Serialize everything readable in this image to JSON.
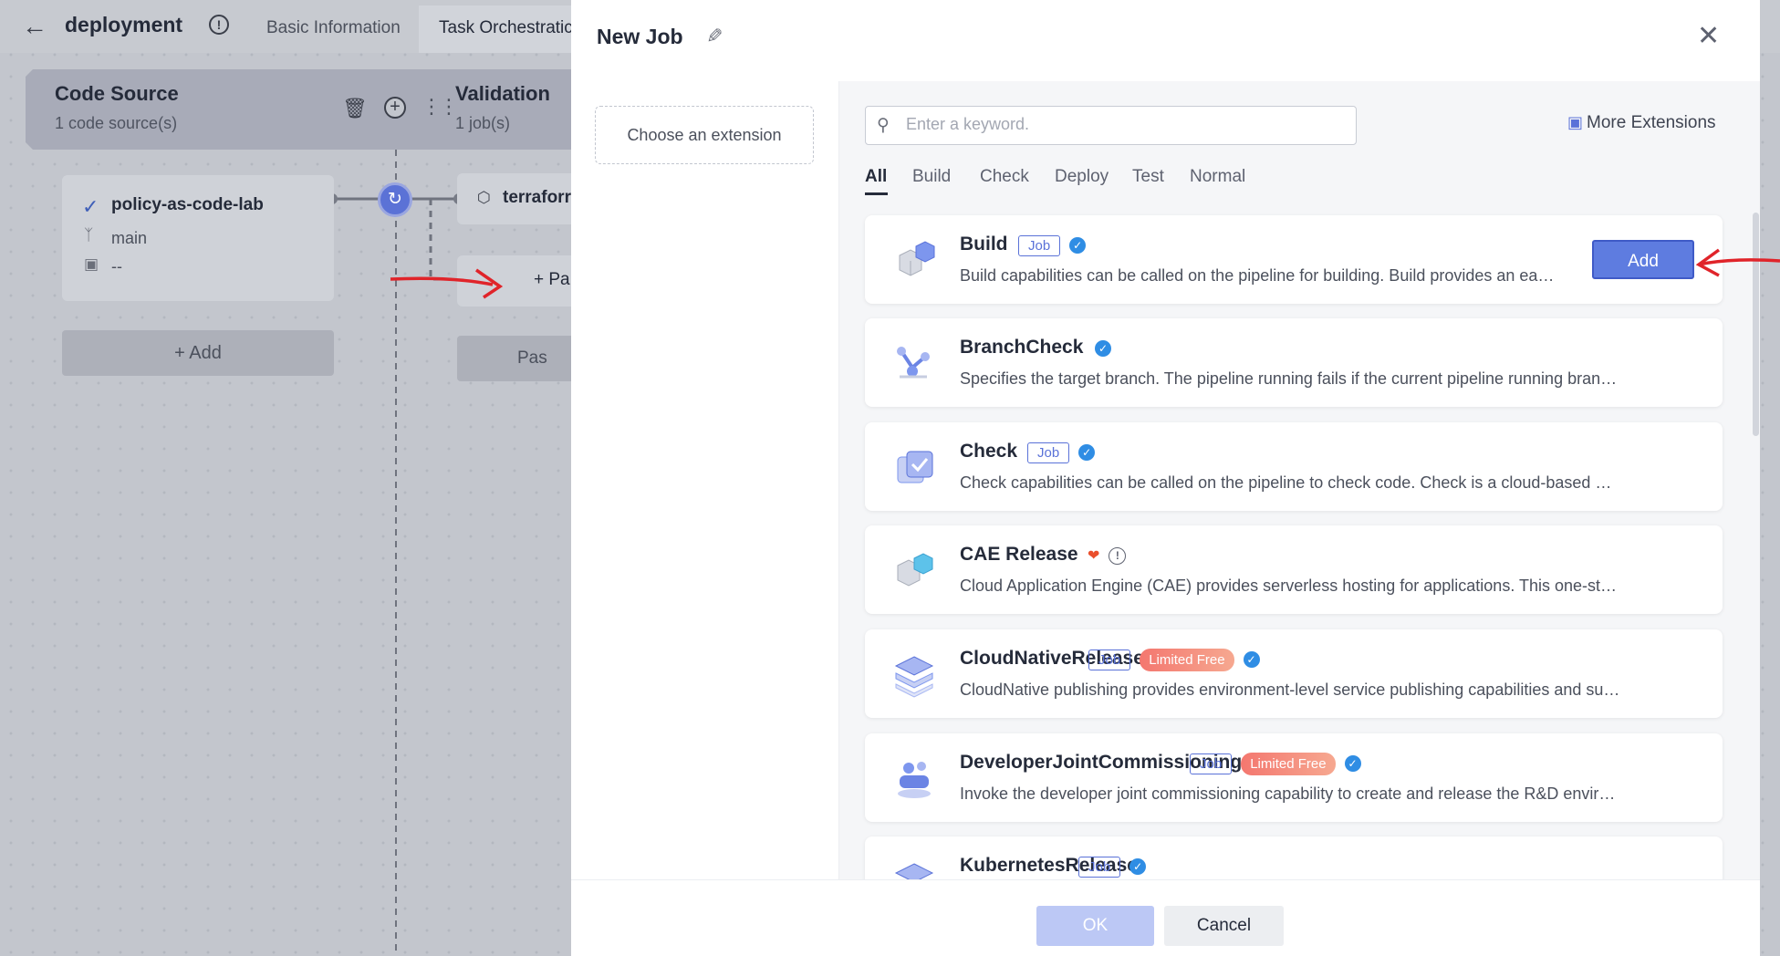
{
  "header": {
    "back_icon": "back-arrow-icon",
    "pipeline_title": "deployment",
    "tabs": [
      "Basic Information",
      "Task Orchestratic"
    ]
  },
  "pipeline": {
    "stages": [
      {
        "title": "Code Source",
        "sub": "1 code source(s)"
      },
      {
        "title": "Validation",
        "sub": "1 job(s)"
      }
    ],
    "repo": {
      "name": "policy-as-code-lab",
      "branch": "main",
      "extra": "--"
    },
    "add_label": "+ Add",
    "job_name": "terraforr",
    "parallel_label": "+ Pa",
    "pass_label": "Pas"
  },
  "drawer": {
    "title": "New Job",
    "choose_extension": "Choose an extension",
    "search_placeholder": "Enter a keyword.",
    "more_extensions": "More Extensions",
    "tabs": [
      "All",
      "Build",
      "Check",
      "Deploy",
      "Test",
      "Normal"
    ],
    "active_tab": "All",
    "items": [
      {
        "name": "Build",
        "badges": [
          "Job"
        ],
        "verified": true,
        "desc": "Build capabilities can be called on the pipeline for building. Build provides an ea…",
        "icon": "build-cube-icon",
        "add_label": "Add"
      },
      {
        "name": "BranchCheck",
        "badges": [],
        "verified": true,
        "desc": "Specifies the target branch. The pipeline running fails if the current pipeline running bran…",
        "icon": "branch-check-icon"
      },
      {
        "name": "Check",
        "badges": [
          "Job"
        ],
        "verified": true,
        "desc": "Check capabilities can be called on the pipeline to check code. Check is a cloud-based …",
        "icon": "check-shield-icon"
      },
      {
        "name": "CAE Release",
        "badges": [],
        "hot": true,
        "info": true,
        "desc": "Cloud Application Engine (CAE) provides serverless hosting for applications. This one-st…",
        "icon": "cae-release-icon"
      },
      {
        "name": "CloudNativeRelease",
        "badges": [
          "Job"
        ],
        "limited": "Limited Free",
        "verified": true,
        "desc": "CloudNative publishing provides environment-level service publishing capabilities and su…",
        "icon": "cloudnative-release-icon"
      },
      {
        "name": "DeveloperJointCommissioning",
        "badges": [
          "Job"
        ],
        "limited": "Limited Free",
        "verified": true,
        "desc": "Invoke the developer joint commissioning capability to create and release the R&D envir…",
        "icon": "developer-commissioning-icon"
      },
      {
        "name": "KubernetesRelease",
        "badges": [
          "Job"
        ],
        "verified": true,
        "desc": "",
        "icon": "kubernetes-release-icon"
      }
    ],
    "ok_label": "OK",
    "cancel_label": "Cancel"
  },
  "colors": {
    "accent": "#5e7ce0",
    "annotation": "#e0242a"
  }
}
